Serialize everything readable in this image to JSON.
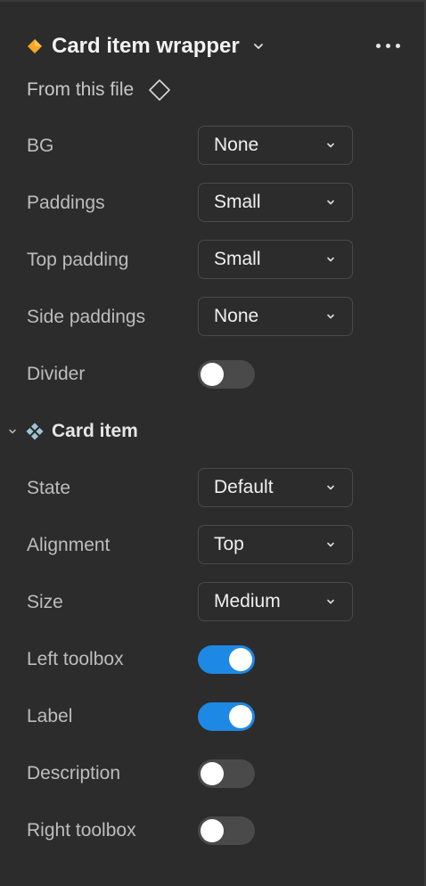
{
  "header": {
    "title": "Card item wrapper",
    "accent_color": "#f5a623",
    "icon": "component-instance-icon"
  },
  "source": {
    "label": "From this file",
    "icon": "component-diamond-icon"
  },
  "wrapper_props": [
    {
      "label": "BG",
      "type": "dropdown",
      "value": "None"
    },
    {
      "label": "Paddings",
      "type": "dropdown",
      "value": "Small"
    },
    {
      "label": "Top padding",
      "type": "dropdown",
      "value": "Small"
    },
    {
      "label": "Side paddings",
      "type": "dropdown",
      "value": "None"
    },
    {
      "label": "Divider",
      "type": "toggle",
      "on": false
    }
  ],
  "section": {
    "title": "Card item",
    "expanded": true,
    "icon": "component-main-icon"
  },
  "card_props": [
    {
      "label": "State",
      "type": "dropdown",
      "value": "Default"
    },
    {
      "label": "Alignment",
      "type": "dropdown",
      "value": "Top"
    },
    {
      "label": "Size",
      "type": "dropdown",
      "value": "Medium"
    },
    {
      "label": "Left toolbox",
      "type": "toggle",
      "on": true
    },
    {
      "label": "Label",
      "type": "toggle",
      "on": true
    },
    {
      "label": "Description",
      "type": "toggle",
      "on": false
    },
    {
      "label": "Right toolbox",
      "type": "toggle",
      "on": false
    }
  ],
  "colors": {
    "toggle_on": "#1e88e5",
    "toggle_off": "#4a4a4a",
    "background": "#2c2c2c"
  }
}
